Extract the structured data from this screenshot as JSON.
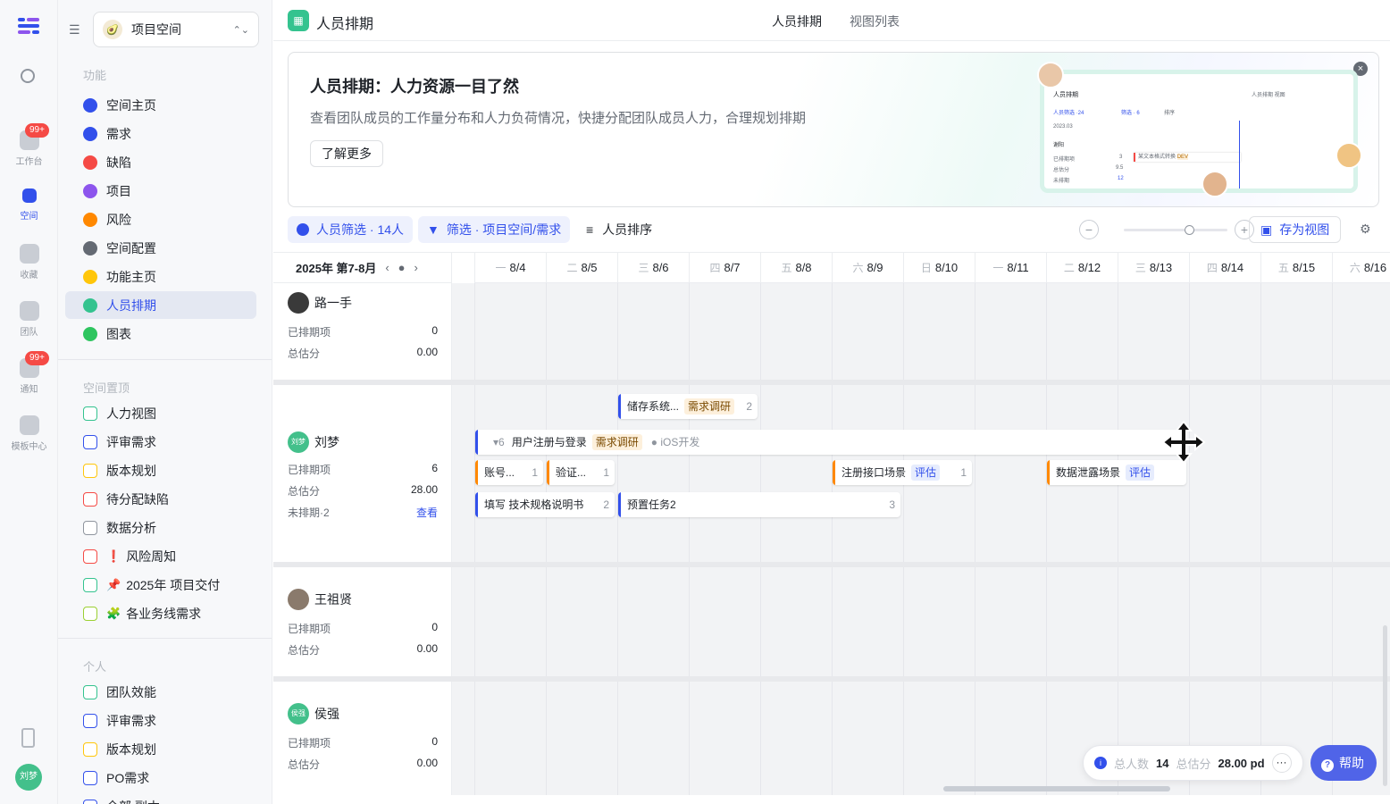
{
  "rail": {
    "items": [
      {
        "label": "工作台",
        "badge": "99+"
      },
      {
        "label": "空间"
      },
      {
        "label": "收藏"
      },
      {
        "label": "团队"
      },
      {
        "label": "通知",
        "badge": "99+"
      },
      {
        "label": "模板中心"
      }
    ],
    "avatar": "刘梦"
  },
  "sidebar": {
    "space_name": "项目空间",
    "sections": {
      "features": "功能",
      "pinned": "空间置顶",
      "personal": "个人"
    },
    "features": [
      {
        "label": "空间主页",
        "color": "#3250eb"
      },
      {
        "label": "需求",
        "color": "#3250eb"
      },
      {
        "label": "缺陷",
        "color": "#f54a45"
      },
      {
        "label": "项目",
        "color": "#8d55ed"
      },
      {
        "label": "风险",
        "color": "#ff8800"
      },
      {
        "label": "空间配置",
        "color": "#646a73"
      },
      {
        "label": "功能主页",
        "color": "#ffc60a"
      },
      {
        "label": "人员排期",
        "color": "#34c38f"
      },
      {
        "label": "图表",
        "color": "#2ec55f"
      }
    ],
    "pinned": [
      {
        "label": "人力视图",
        "color": "#34c38f"
      },
      {
        "label": "评审需求",
        "color": "#3250eb"
      },
      {
        "label": "版本规划",
        "color": "#ffc60a"
      },
      {
        "label": "待分配缺陷",
        "color": "#f54a45"
      },
      {
        "label": "数据分析",
        "color": "#8f959e"
      },
      {
        "label": "风险周知",
        "emoji": "❗",
        "color": "#f54a45"
      },
      {
        "label": "2025年 项目交付",
        "emoji": "📌",
        "color": "#34c38f"
      },
      {
        "label": "各业务线需求",
        "emoji": "🧩",
        "color": "#9bd032"
      }
    ],
    "personal": [
      {
        "label": "团队效能",
        "color": "#34c38f"
      },
      {
        "label": "评审需求",
        "color": "#3250eb"
      },
      {
        "label": "版本规划",
        "color": "#ffc60a"
      },
      {
        "label": "PO需求",
        "color": "#3250eb"
      },
      {
        "label": "全部 副本",
        "color": "#3250eb"
      }
    ]
  },
  "topbar": {
    "title": "人员排期",
    "tabs": [
      "人员排期",
      "视图列表"
    ]
  },
  "banner": {
    "title": "人员排期：人力资源一目了然",
    "desc": "查看团队成员的工作量分布和人力负荷情况，快捷分配团队成员人力，合理规划排期",
    "more": "了解更多",
    "mini_title": "人员排期",
    "mini_tabs": "人员排期   视图",
    "mini_filter": "人员筛选 ·24",
    "mini_filter2": "筛选 · 6",
    "mini_sort": "排序",
    "mini_month": "2023.03",
    "mini_user": "谢阳",
    "mini_task": "某文本格式转换",
    "mini_tag": "DEV",
    "mini_rows": [
      "已排期项",
      "总估分",
      "未排期"
    ],
    "mini_vals": [
      "3",
      "9.5",
      "12"
    ]
  },
  "toolbar": {
    "member_filter": "人员筛选 · 14人",
    "filter": "筛选 · 项目空间/需求",
    "sort": "人员排序",
    "zoom_out": "−",
    "zoom_in": "+",
    "save_view": "存为视图"
  },
  "calendar": {
    "range": "2025年 第7-8月",
    "days": [
      {
        "wd": "一",
        "d": "8/4"
      },
      {
        "wd": "二",
        "d": "8/5"
      },
      {
        "wd": "三",
        "d": "8/6"
      },
      {
        "wd": "四",
        "d": "8/7"
      },
      {
        "wd": "五",
        "d": "8/8"
      },
      {
        "wd": "六",
        "d": "8/9"
      },
      {
        "wd": "日",
        "d": "8/10"
      },
      {
        "wd": "一",
        "d": "8/11"
      },
      {
        "wd": "二",
        "d": "8/12"
      },
      {
        "wd": "三",
        "d": "8/13"
      },
      {
        "wd": "四",
        "d": "8/14"
      },
      {
        "wd": "五",
        "d": "8/15"
      },
      {
        "wd": "六",
        "d": "8/16"
      }
    ]
  },
  "members": [
    {
      "name": "路一手",
      "scheduled_label": "已排期项",
      "scheduled": "0",
      "estimate_label": "总估分",
      "estimate": "0.00"
    },
    {
      "name": "刘梦",
      "avatar_text": "刘梦",
      "scheduled_label": "已排期项",
      "scheduled": "6",
      "estimate_label": "总估分",
      "estimate": "28.00",
      "unscheduled_label": "未排期·2",
      "view_link": "查看",
      "tasks": {
        "t1": {
          "title": "储存系统...",
          "tag": "需求调研",
          "count": "2"
        },
        "t2": {
          "collapse": "▾6",
          "title": "用户注册与登录",
          "tag": "需求调研",
          "extra": "iOS开发"
        },
        "t3": {
          "title": "账号...",
          "count": "1"
        },
        "t4": {
          "title": "验证...",
          "count": "1"
        },
        "t5": {
          "title": "注册接口场景",
          "tag": "评估",
          "count": "1"
        },
        "t6": {
          "title": "数据泄露场景",
          "tag": "评估"
        },
        "t7": {
          "title": "填写 技术规格说明书",
          "count": "2"
        },
        "t8": {
          "title": "预置任务2",
          "count": "3"
        }
      }
    },
    {
      "name": "王祖贤",
      "scheduled_label": "已排期项",
      "scheduled": "0",
      "estimate_label": "总估分",
      "estimate": "0.00"
    },
    {
      "name": "侯强",
      "avatar_text": "侯强",
      "scheduled_label": "已排期项",
      "scheduled": "0",
      "estimate_label": "总估分",
      "estimate": "0.00"
    }
  ],
  "footer": {
    "total_people_label": "总人数",
    "total_people": "14",
    "total_estimate_label": "总估分",
    "total_estimate": "28.00 pd",
    "help": "帮助"
  },
  "colors": {
    "accent": "#3250eb",
    "task_orange": "#ff8800",
    "task_blue": "#3250eb"
  }
}
